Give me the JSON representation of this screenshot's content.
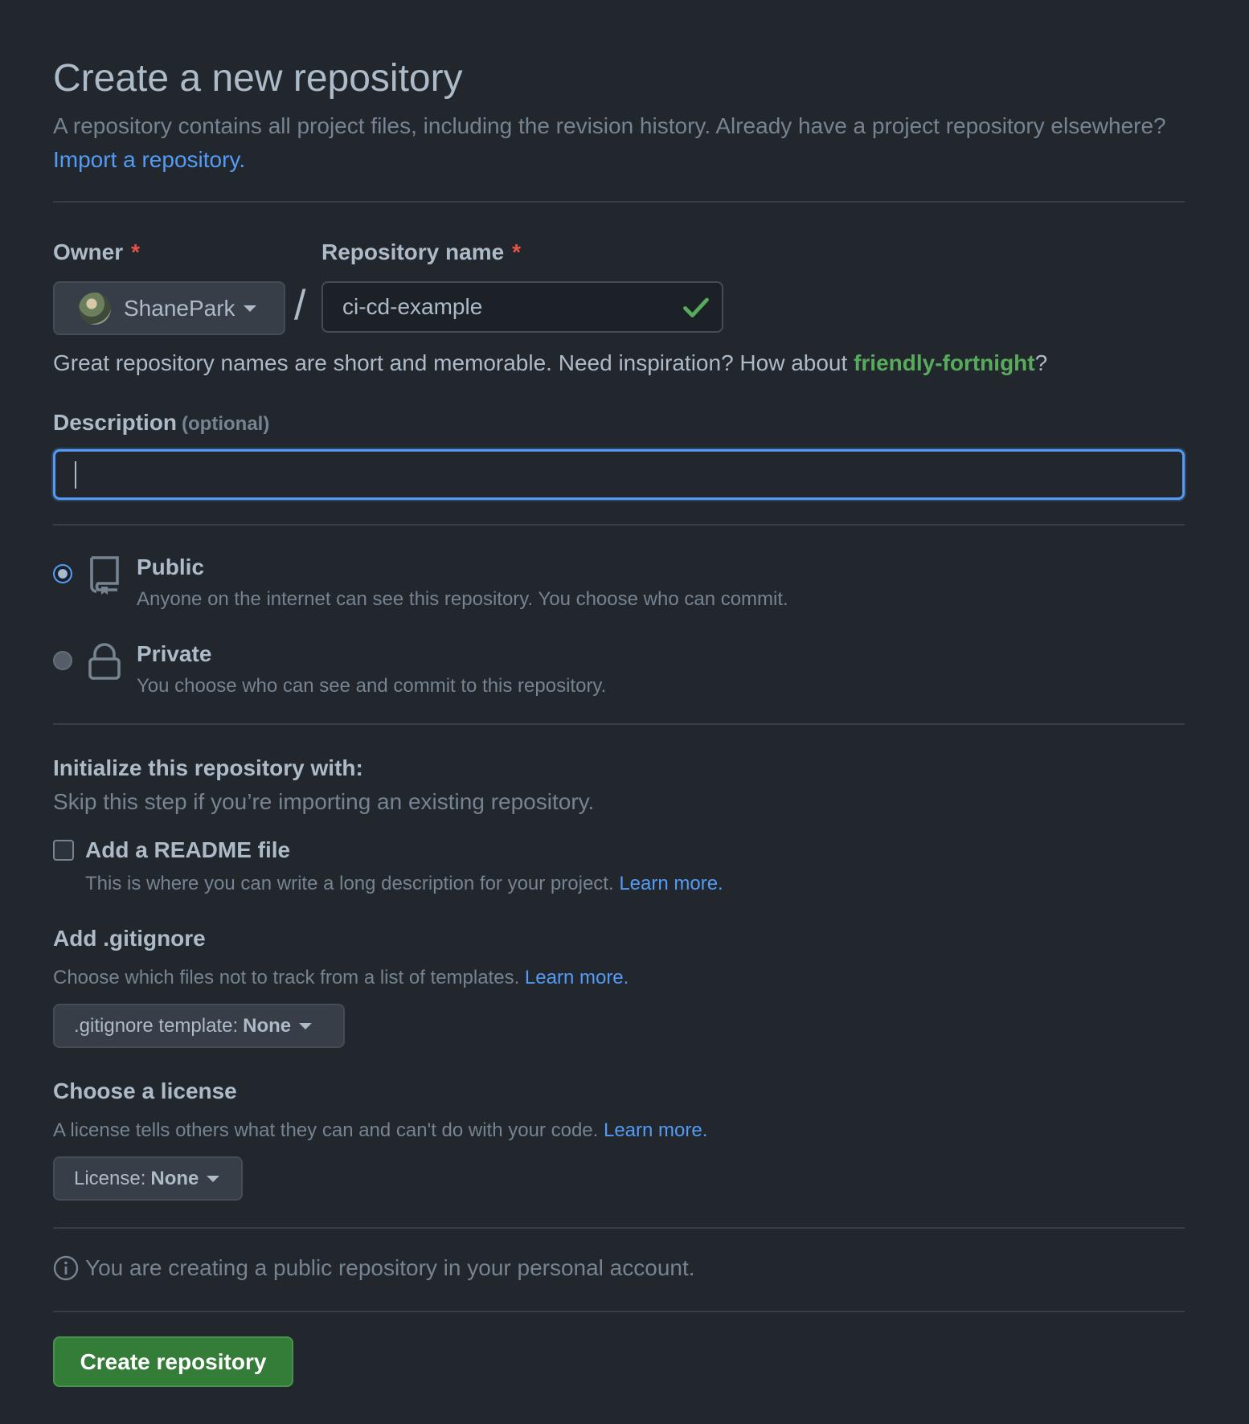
{
  "header": {
    "title": "Create a new repository",
    "subtitle": "A repository contains all project files, including the revision history. Already have a project repository elsewhere?",
    "import_link": "Import a repository."
  },
  "owner": {
    "label": "Owner",
    "required_mark": "*",
    "value": "ShanePark"
  },
  "repo_name": {
    "label": "Repository name",
    "required_mark": "*",
    "value": "ci-cd-example",
    "valid": true
  },
  "name_hint": {
    "text": "Great repository names are short and memorable. Need inspiration? How about",
    "suggestion": "friendly-fortnight",
    "suffix": "?"
  },
  "description": {
    "label": "Description",
    "optional": "(optional)",
    "value": ""
  },
  "visibility": {
    "selected": "public",
    "options": [
      {
        "id": "public",
        "title": "Public",
        "desc": "Anyone on the internet can see this repository. You choose who can commit."
      },
      {
        "id": "private",
        "title": "Private",
        "desc": "You choose who can see and commit to this repository."
      }
    ]
  },
  "init": {
    "title": "Initialize this repository with:",
    "subtitle": "Skip this step if you’re importing an existing repository.",
    "readme": {
      "label": "Add a README file",
      "desc": "This is where you can write a long description for your project.",
      "learn_more": "Learn more.",
      "checked": false
    }
  },
  "gitignore": {
    "title": "Add .gitignore",
    "desc": "Choose which files not to track from a list of templates.",
    "learn_more": "Learn more.",
    "button_prefix": ".gitignore template:",
    "button_value": "None"
  },
  "license": {
    "title": "Choose a license",
    "desc": "A license tells others what they can and can't do with your code.",
    "learn_more": "Learn more.",
    "button_prefix": "License:",
    "button_value": "None"
  },
  "notice": "You are creating a public repository in your personal account.",
  "submit_label": "Create repository",
  "colors": {
    "background": "#22272e",
    "accent": "#539bf5",
    "success": "#57ab5a",
    "primary_button": "#347d39",
    "required": "#e5534b"
  }
}
